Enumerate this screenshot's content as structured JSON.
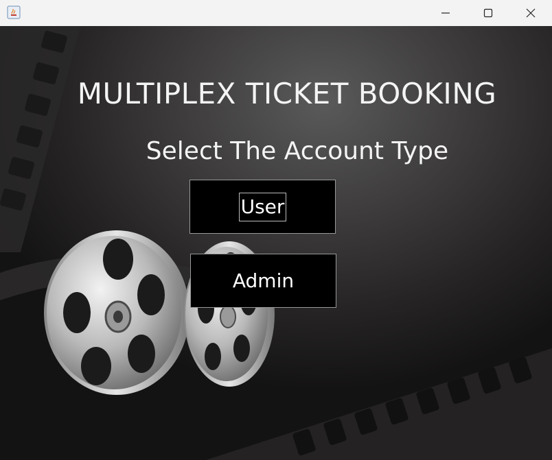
{
  "window": {
    "icon": "java-app-icon",
    "controls": {
      "minimize": "minimize-icon",
      "maximize": "maximize-icon",
      "close": "close-icon"
    }
  },
  "main": {
    "title": "MULTIPLEX TICKET BOOKING",
    "subtitle": "Select The Account Type",
    "buttons": {
      "user": "User",
      "admin": "Admin"
    }
  },
  "background": {
    "art": "film-reel-and-filmstrip"
  },
  "colors": {
    "button_bg": "#000000",
    "text": "#ffffff",
    "titlebar": "#f3f3f3"
  }
}
